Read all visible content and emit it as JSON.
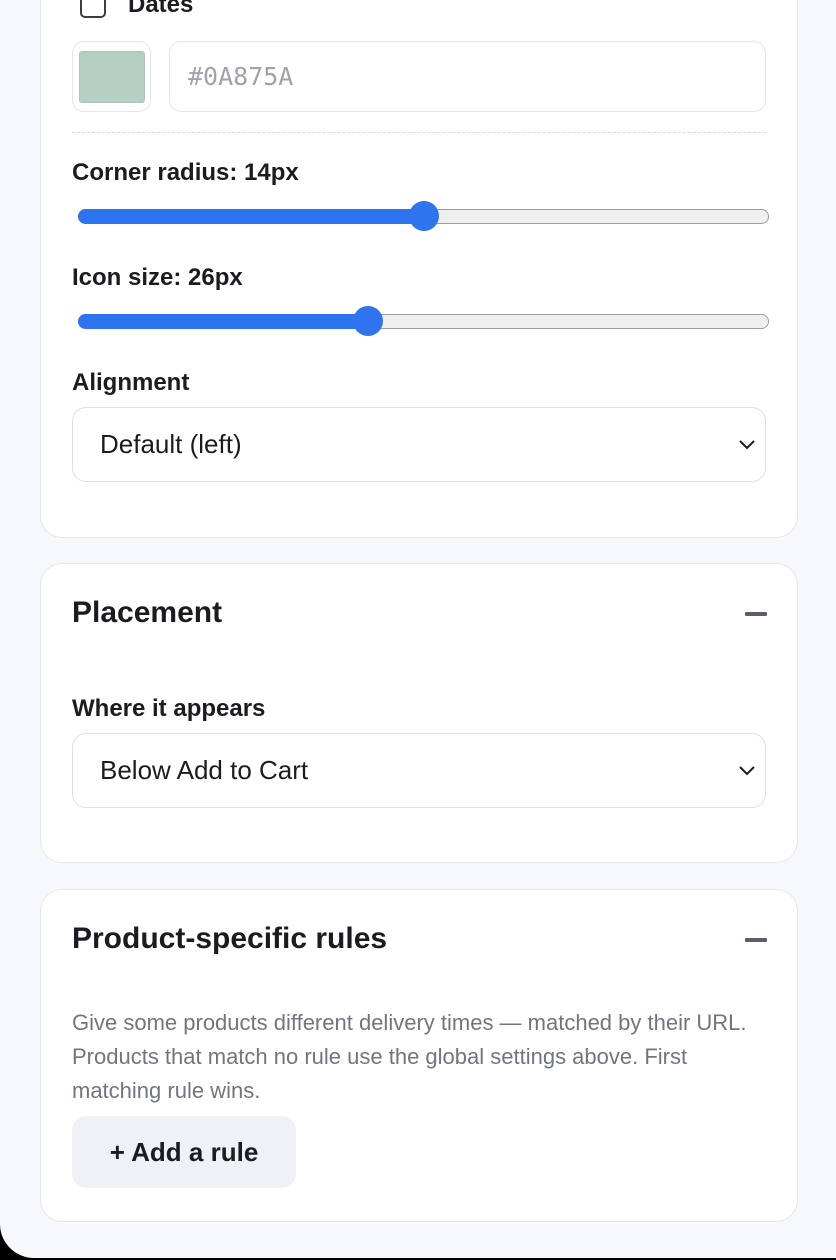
{
  "appearance": {
    "dates_checkbox": {
      "label": "Dates",
      "checked": false
    },
    "color": {
      "swatch_hex": "#b4d0c3",
      "placeholder": "#0A875A"
    },
    "corner_radius": {
      "label": "Corner radius: 14px",
      "fill_percent": 50
    },
    "icon_size": {
      "label": "Icon size: 26px",
      "fill_percent": 42
    },
    "alignment": {
      "label": "Alignment",
      "selected": "Default (left)"
    }
  },
  "placement": {
    "title": "Placement",
    "where_label": "Where it appears",
    "where_selected": "Below Add to Cart"
  },
  "product_rules": {
    "title": "Product-specific rules",
    "helper": "Give some products different delivery times — matched by their URL. Products that match no rule use the global settings above. First matching rule wins.",
    "add_button": "+ Add a rule"
  },
  "icons": {
    "collapse": "minus-icon",
    "dropdown": "chevron-down-icon"
  },
  "colors": {
    "accent": "#2f74ef",
    "swatch": "#b4d0c3"
  }
}
